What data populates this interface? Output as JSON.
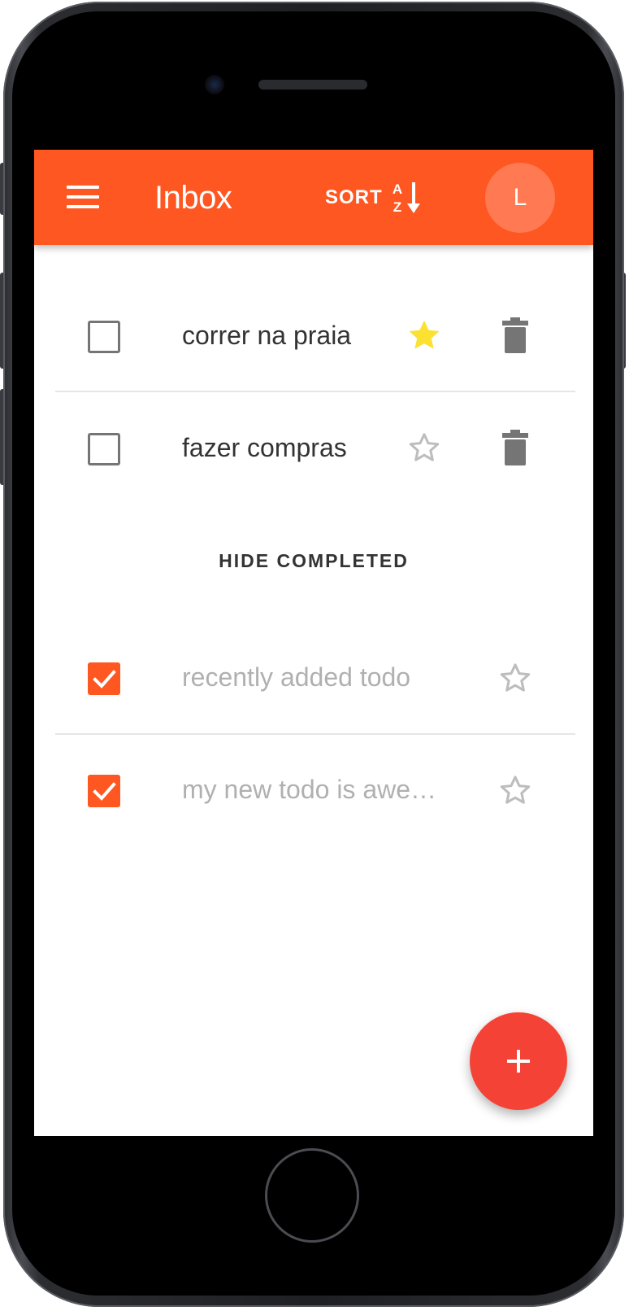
{
  "appbar": {
    "title": "Inbox",
    "sort_label": "SORT",
    "sort_icon": "sort-alpha-icon",
    "menu_icon": "menu-icon",
    "avatar_initial": "L",
    "color": "#ff5722"
  },
  "todos": [
    {
      "text": "correr na praia",
      "completed": false,
      "starred": true
    },
    {
      "text": "fazer compras",
      "completed": false,
      "starred": false
    }
  ],
  "hide_completed_label": "HIDE COMPLETED",
  "completed_todos": [
    {
      "text": "recently added todo",
      "completed": true,
      "starred": false
    },
    {
      "text": "my new todo is awe…",
      "completed": true,
      "starred": false
    }
  ],
  "fab": {
    "icon": "plus-icon",
    "color": "#f44336"
  },
  "colors": {
    "accent": "#ff5722",
    "star_active": "#fbe232",
    "star_inactive": "#bdbdbd",
    "trash": "#757575"
  }
}
